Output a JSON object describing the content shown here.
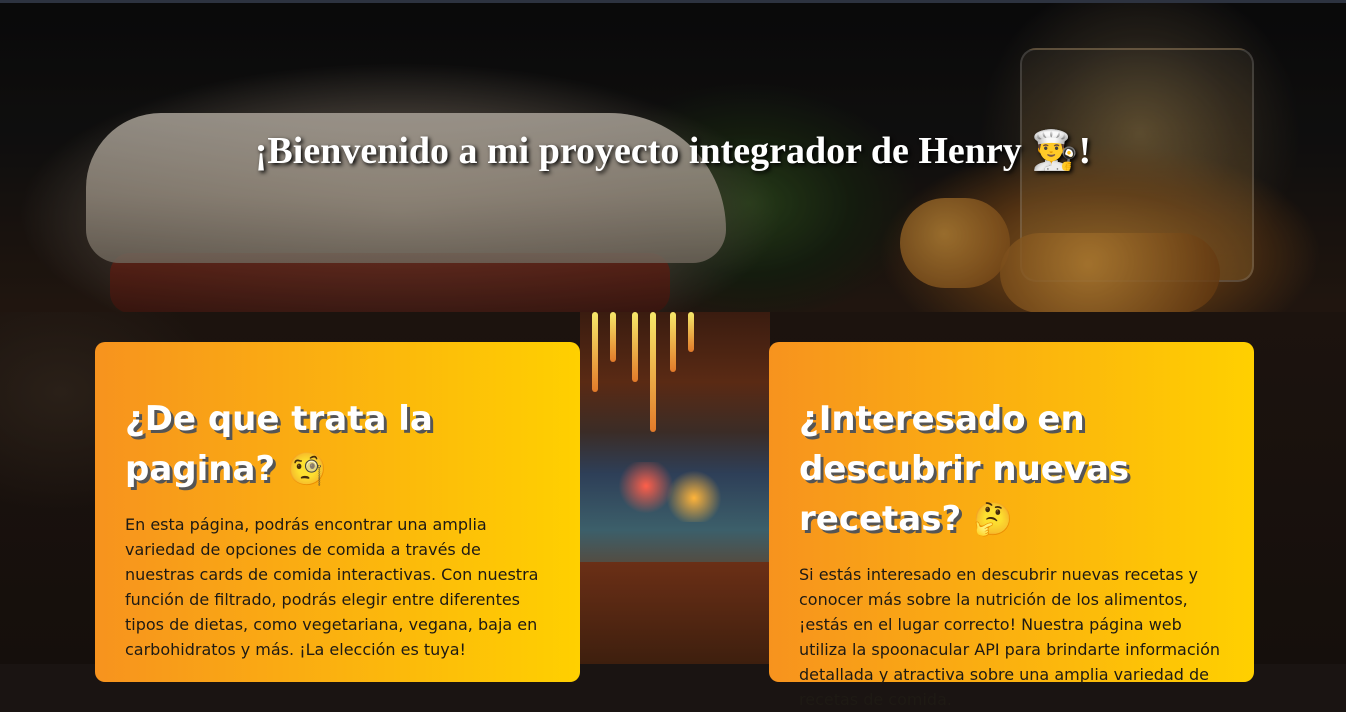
{
  "hero": {
    "title": "¡Bienvenido a mi proyecto integrador de Henry 👨‍🍳!"
  },
  "cards": [
    {
      "title": "¿De que trata la pagina?",
      "emoji": "🧐",
      "body": "En esta página, podrás encontrar una amplia variedad de opciones de comida a través de nuestras cards de comida interactivas. Con nuestra función de filtrado, podrás elegir entre diferentes tipos de dietas, como vegetariana, vegana, baja en carbohidratos y más. ¡La elección es tuya!"
    },
    {
      "title": "¿Interesado en descubrir nuevas recetas?",
      "emoji": "🤔",
      "body": "Si estás interesado en descubrir nuevas recetas y conocer más sobre la nutrición de los alimentos, ¡estás en el lugar correcto! Nuestra página web utiliza la spoonacular API para brindarte información detallada y atractiva sobre una amplia variedad de recetas de comida."
    }
  ],
  "colors": {
    "card_gradient_start": "#f7931e",
    "card_gradient_end": "#ffd000"
  }
}
